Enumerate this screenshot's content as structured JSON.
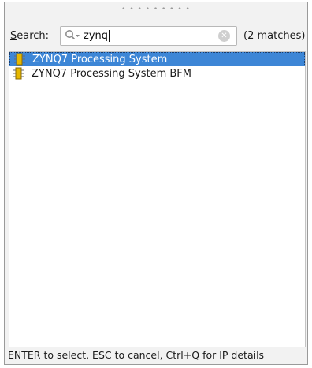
{
  "search": {
    "label_mnemonic": "S",
    "label_rest": "earch:",
    "value": "zynq",
    "match_count": "(2 matches)",
    "icon": "search-icon",
    "clear_icon": "clear-icon"
  },
  "results": [
    {
      "label": "ZYNQ7 Processing System",
      "selected": true,
      "icon": "ip-core-icon"
    },
    {
      "label": "ZYNQ7 Processing System BFM",
      "selected": false,
      "icon": "ip-core-icon"
    }
  ],
  "status_bar": {
    "text": "ENTER to select, ESC to cancel, Ctrl+Q for IP details"
  },
  "colors": {
    "selection": "#3d86d6",
    "ip_icon": "#e6b800"
  }
}
